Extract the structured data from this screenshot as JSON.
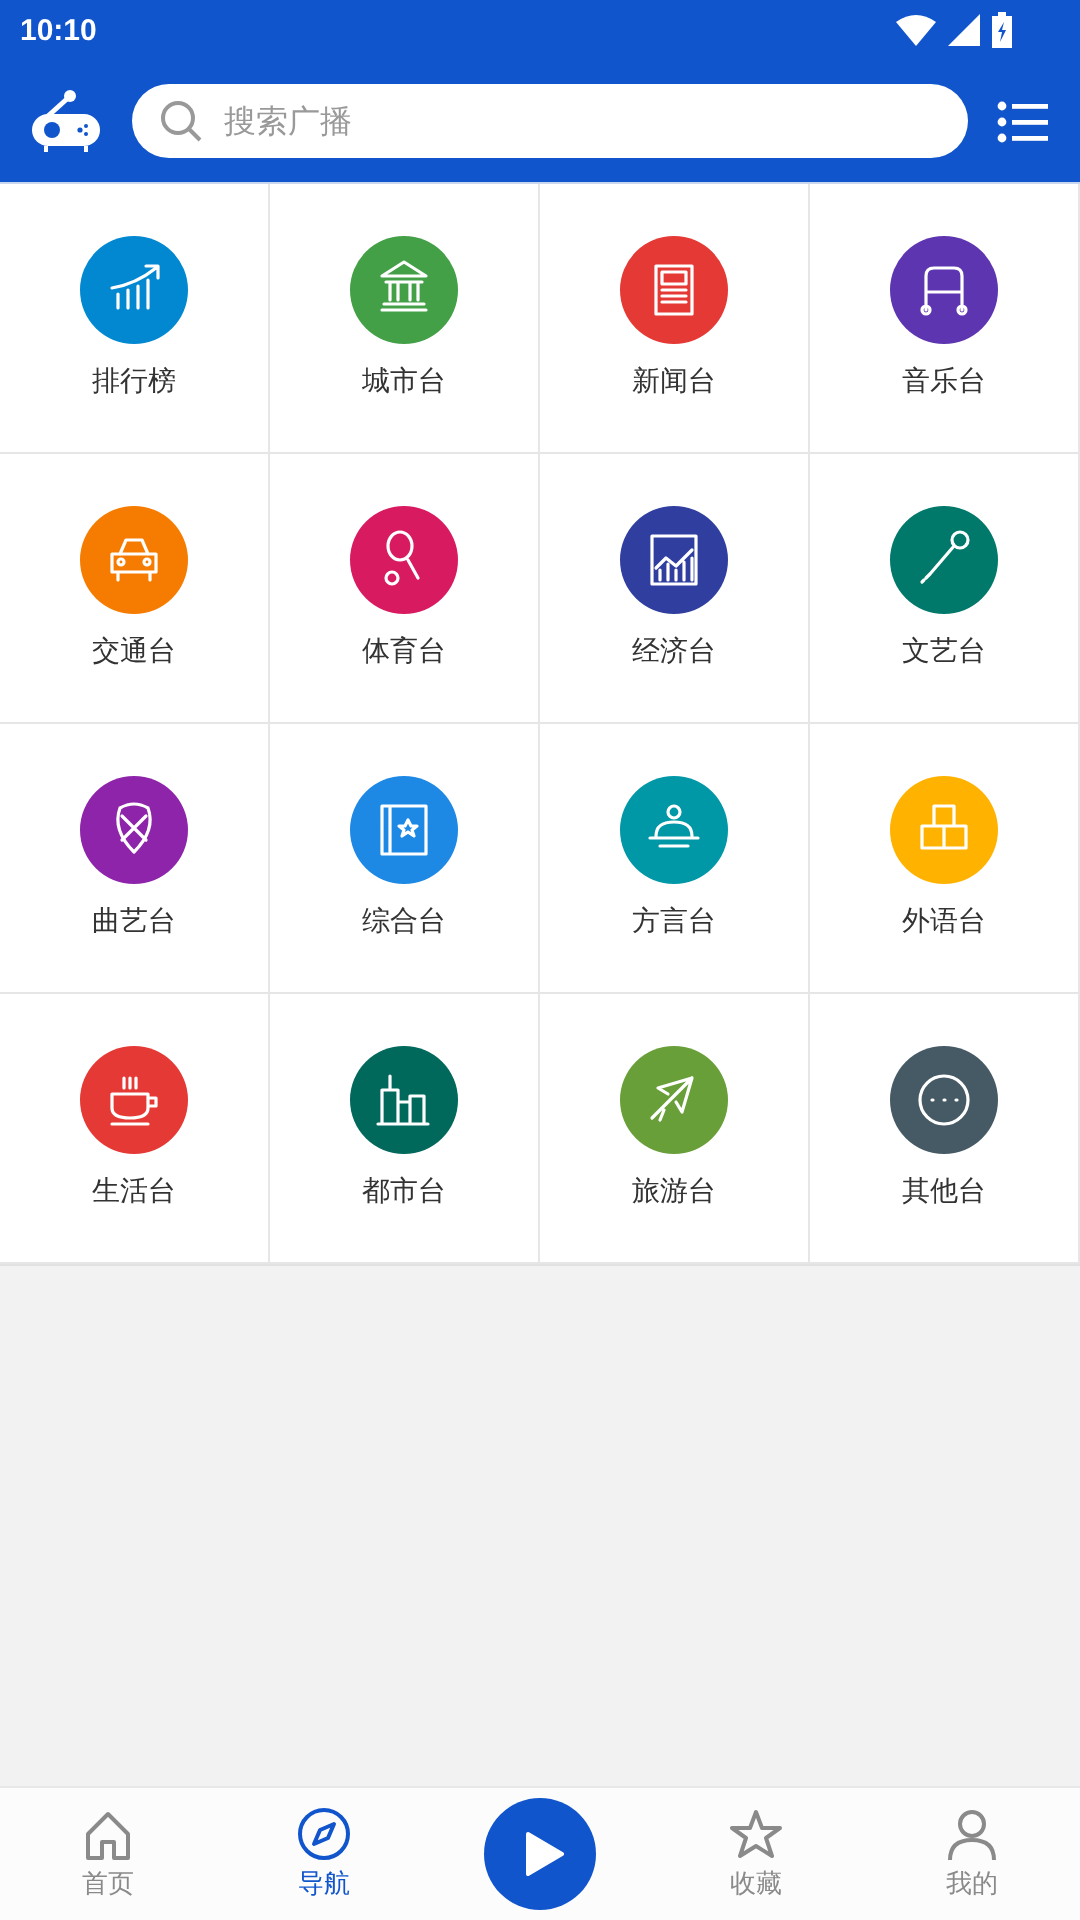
{
  "status_bar": {
    "time": "10:10"
  },
  "search": {
    "placeholder": "搜索广播"
  },
  "categories": [
    {
      "label": "排行榜",
      "color": "#0288d1"
    },
    {
      "label": "城市台",
      "color": "#43a047"
    },
    {
      "label": "新闻台",
      "color": "#e53935"
    },
    {
      "label": "音乐台",
      "color": "#5e35b1"
    },
    {
      "label": "交通台",
      "color": "#f57c00"
    },
    {
      "label": "体育台",
      "color": "#d81b60"
    },
    {
      "label": "经济台",
      "color": "#303f9f"
    },
    {
      "label": "文艺台",
      "color": "#00796b"
    },
    {
      "label": "曲艺台",
      "color": "#8e24aa"
    },
    {
      "label": "综合台",
      "color": "#1e88e5"
    },
    {
      "label": "方言台",
      "color": "#0097a7"
    },
    {
      "label": "外语台",
      "color": "#ffb300"
    },
    {
      "label": "生活台",
      "color": "#e53935"
    },
    {
      "label": "都市台",
      "color": "#00695c"
    },
    {
      "label": "旅游台",
      "color": "#689f38"
    },
    {
      "label": "其他台",
      "color": "#455a64"
    }
  ],
  "bottom_nav": [
    {
      "kind": "tab",
      "label": "首页",
      "selected": false
    },
    {
      "kind": "tab",
      "label": "导航",
      "selected": true
    },
    {
      "kind": "play"
    },
    {
      "kind": "tab",
      "label": "收藏",
      "selected": false
    },
    {
      "kind": "tab",
      "label": "我的",
      "selected": false
    }
  ]
}
